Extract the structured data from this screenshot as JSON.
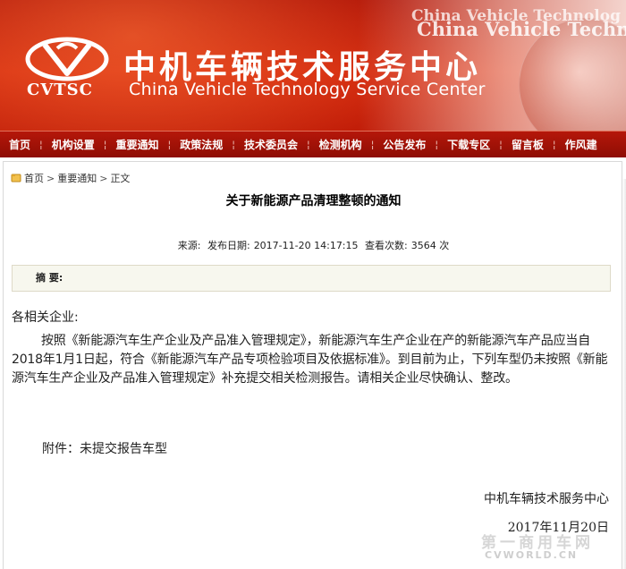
{
  "header": {
    "logo_text": "CVTSC",
    "site_name_cn": "中机车辆技术服务中心",
    "site_name_en": "China Vehicle Technology Service Center",
    "banner_en_large": "China Vehicle Technolo",
    "banner_en_small": "China Vehicle Technolog"
  },
  "nav": {
    "items": [
      {
        "label": "首页"
      },
      {
        "label": "机构设置"
      },
      {
        "label": "重要通知"
      },
      {
        "label": "政策法规"
      },
      {
        "label": "技术委员会"
      },
      {
        "label": "检测机构"
      },
      {
        "label": "公告发布"
      },
      {
        "label": "下载专区"
      },
      {
        "label": "留言板"
      },
      {
        "label": "作风建"
      }
    ],
    "separator": "¦"
  },
  "breadcrumb": {
    "home": "首页",
    "section": "重要通知",
    "current": "正文",
    "sep": ">"
  },
  "article": {
    "title": "关于新能源产品清理整顿的通知",
    "source_label": "来源:",
    "date_label": "发布日期:",
    "date_value": "2017-11-20 14:17:15",
    "views_label": "查看次数:",
    "views_value": "3564 次",
    "summary_label": "摘 要:",
    "salutation": "各相关企业:",
    "paragraph": "按照《新能源汽车生产企业及产品准入管理规定》，新能源汽车生产企业在产的新能源汽车产品应当自2018年1月1日起，符合《新能源汽车产品专项检验项目及依据标准》。到目前为止，下列车型仍未按照《新能源汽车生产企业及产品准入管理规定》补充提交相关检测报告。请相关企业尽快确认、整改。",
    "attachment": "附件：未提交报告车型",
    "signature": "中机车辆技术服务中心",
    "sign_date": "2017年11月20日"
  },
  "watermark": {
    "cn": "第一商用车网",
    "en": "CVWORLD.CN"
  },
  "colors": {
    "banner_red": "#c11d08",
    "nav_red": "#9e1206",
    "summary_bg": "#f7f7ee"
  }
}
